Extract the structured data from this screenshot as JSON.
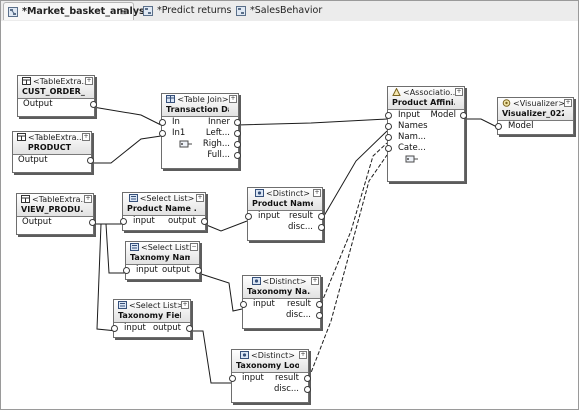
{
  "tabs": [
    {
      "label": "*Market_basket_analysis",
      "close": "⊠"
    },
    {
      "label": "*Predict returns",
      "close": ""
    },
    {
      "label": "*SalesBehavior",
      "close": ""
    }
  ],
  "nodes": {
    "cust_order": {
      "stereotype": "<TableExtra...",
      "name": "CUST_ORDER_...",
      "ports": [
        "Output"
      ]
    },
    "product": {
      "stereotype": "<TableExtra...",
      "name": "PRODUCT",
      "ports": [
        "Output"
      ]
    },
    "table_join": {
      "stereotype": "<Table Join>",
      "name": "Transaction Da...",
      "ports_left": [
        "In",
        "In1"
      ],
      "ports_right": [
        "Inner",
        "Left...",
        "Righ...",
        "Full..."
      ]
    },
    "association": {
      "stereotype": "<Associatio...",
      "name": "Product Affini...",
      "ports_left": [
        "Input",
        "Names",
        "Nam...",
        "Cate..."
      ],
      "ports_right": [
        "Model"
      ]
    },
    "visualizer": {
      "stereotype": "<Visualizer>",
      "name": "Visualizer_022",
      "ports": [
        "Model"
      ]
    },
    "view_product": {
      "stereotype": "<TableExtra...",
      "name": "VIEW_PRODU...",
      "ports": [
        "Output"
      ]
    },
    "select_product_name": {
      "stereotype": "<Select List>",
      "name": "Product Name ...",
      "left": "input",
      "right": "output"
    },
    "distinct_product_name": {
      "stereotype": "<Distinct>",
      "name": "Product Name ...",
      "left": "input",
      "right": [
        "result",
        "disc..."
      ]
    },
    "select_taxonomy_name": {
      "stereotype": "<Select List>",
      "name": "Taxnomy Nam...",
      "left": "input",
      "right": "output"
    },
    "distinct_taxonomy_name": {
      "stereotype": "<Distinct>",
      "name": "Taxonomy Na...",
      "left": "input",
      "right": [
        "result",
        "disc..."
      ]
    },
    "select_taxonomy_fields": {
      "stereotype": "<Select List>",
      "name": "Taxonomy Fields",
      "left": "input",
      "right": "output"
    },
    "distinct_taxonomy_lookup": {
      "stereotype": "<Distinct>",
      "name": "Taxonomy Loo...",
      "left": "input",
      "right": [
        "result",
        "disc..."
      ]
    }
  }
}
